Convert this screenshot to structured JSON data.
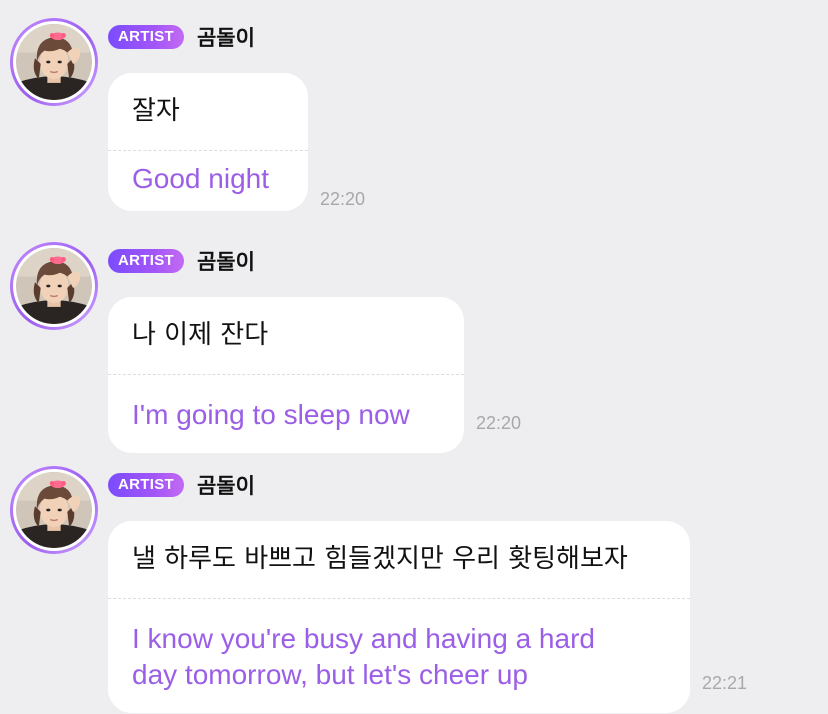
{
  "messages": [
    {
      "badge": "ARTIST",
      "sender": "곰돌이",
      "korean": "잘자",
      "english": "Good night",
      "english_line2": "",
      "time": "22:20"
    },
    {
      "badge": "ARTIST",
      "sender": "곰돌이",
      "korean": "나 이제 잔다",
      "english": "I'm going to sleep now",
      "english_line2": "",
      "time": "22:20"
    },
    {
      "badge": "ARTIST",
      "sender": "곰돌이",
      "korean": "낼 하루도 바쁘고 힘들겠지만 우리 홧팅해보자",
      "english": "I know you're busy and having a hard",
      "english_line2": "day tomorrow, but let's cheer up",
      "time": "22:21"
    }
  ],
  "colors": {
    "background": "#eeeef0",
    "bubble": "#ffffff",
    "translation": "#9a5fe6",
    "badge_gradient_start": "#7b4cff",
    "badge_gradient_end": "#c26bf2",
    "avatar_ring": "#b47cff",
    "timestamp": "#a8a8a8"
  },
  "icons": {
    "avatar": "artist-profile-photo"
  }
}
